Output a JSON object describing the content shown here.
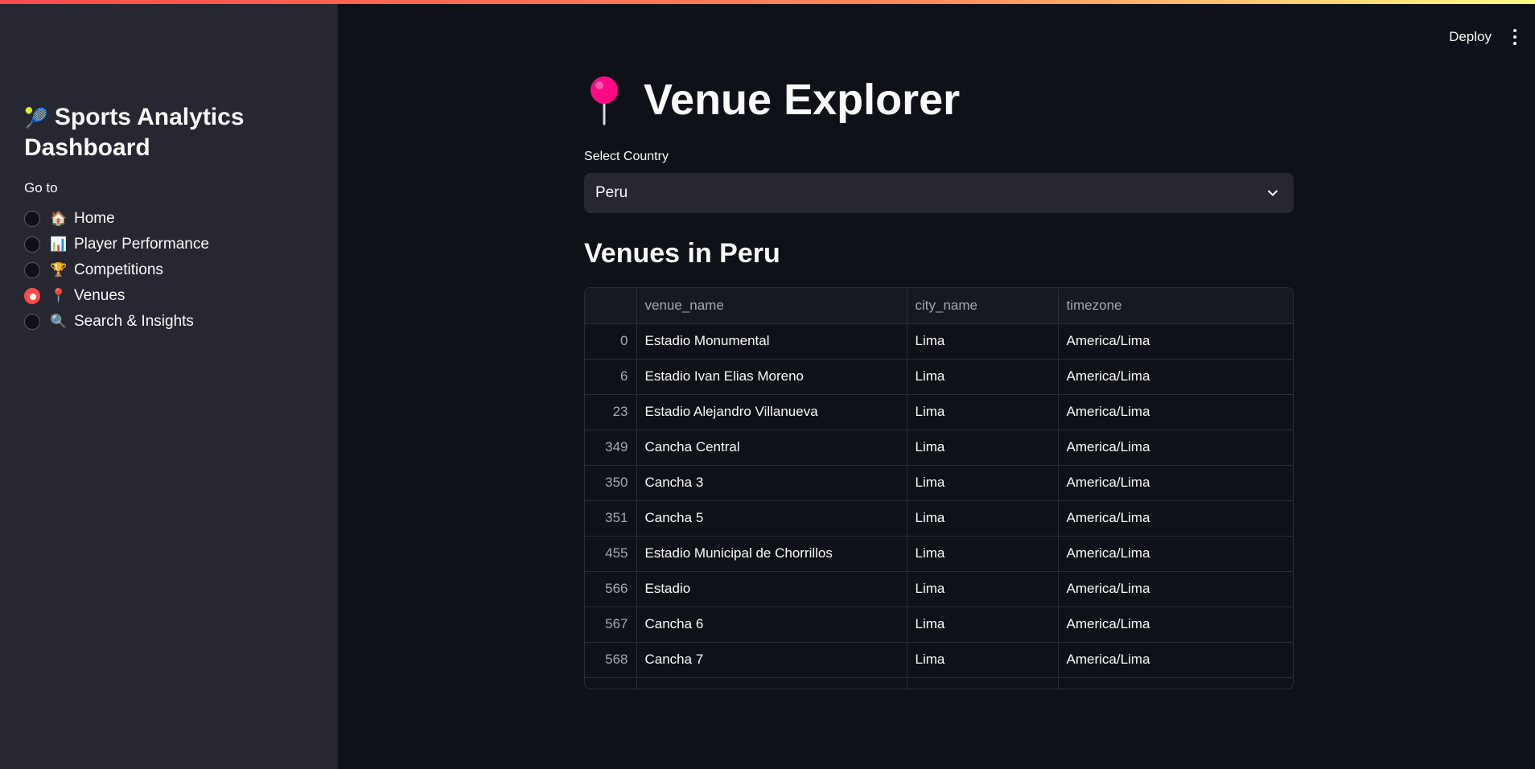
{
  "sidebar": {
    "title_emoji": "🎾",
    "title": "Sports Analytics Dashboard",
    "nav_label": "Go to",
    "items": [
      {
        "emoji": "🏠",
        "label": "Home",
        "selected": false
      },
      {
        "emoji": "📊",
        "label": "Player Performance",
        "selected": false
      },
      {
        "emoji": "🏆",
        "label": "Competitions",
        "selected": false
      },
      {
        "emoji": "📍",
        "label": "Venues",
        "selected": true
      },
      {
        "emoji": "🔍",
        "label": "Search & Insights",
        "selected": false
      }
    ]
  },
  "header": {
    "deploy_label": "Deploy",
    "menu_icon": "kebab-menu-icon"
  },
  "main": {
    "title_icon": "round-pushpin-icon",
    "title": "Venue Explorer",
    "select_label": "Select Country",
    "select_value": "Peru",
    "section_title": "Venues in Peru"
  },
  "table": {
    "columns": [
      "",
      "venue_name",
      "city_name",
      "timezone"
    ],
    "rows": [
      [
        "0",
        "Estadio Monumental",
        "Lima",
        "America/Lima"
      ],
      [
        "6",
        "Estadio Ivan Elias Moreno",
        "Lima",
        "America/Lima"
      ],
      [
        "23",
        "Estadio Alejandro Villanueva",
        "Lima",
        "America/Lima"
      ],
      [
        "349",
        "Cancha Central",
        "Lima",
        "America/Lima"
      ],
      [
        "350",
        "Cancha  3",
        "Lima",
        "America/Lima"
      ],
      [
        "351",
        "Cancha 5",
        "Lima",
        "America/Lima"
      ],
      [
        "455",
        "Estadio Municipal de Chorrillos",
        "Lima",
        "America/Lima"
      ],
      [
        "566",
        "Estadio",
        "Lima",
        "America/Lima"
      ],
      [
        "567",
        "Cancha 6",
        "Lima",
        "America/Lima"
      ],
      [
        "568",
        "Cancha 7",
        "Lima",
        "America/Lima"
      ],
      [
        "",
        "",
        "",
        ""
      ]
    ]
  },
  "colors": {
    "accent": "#ff4b4b",
    "background": "#0e1117",
    "sidebar": "#262730",
    "pin": "#ff0a85"
  }
}
